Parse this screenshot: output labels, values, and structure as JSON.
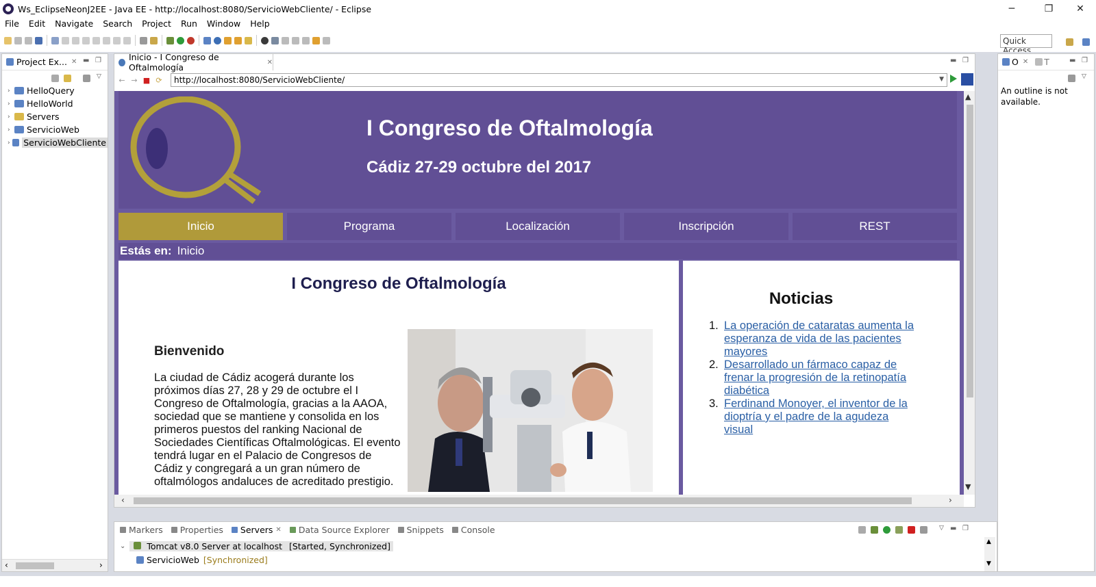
{
  "window": {
    "title": "Ws_EclipseNeonJ2EE - Java EE - http://localhost:8080/ServicioWebCliente/ - Eclipse",
    "controls": [
      "─",
      "❐",
      "✕"
    ]
  },
  "menu": [
    "File",
    "Edit",
    "Navigate",
    "Search",
    "Project",
    "Run",
    "Window",
    "Help"
  ],
  "toolbar": {
    "quick_access": "Quick Access"
  },
  "project_explorer": {
    "tab_label": "Project Ex...",
    "items": [
      "HelloQuery",
      "HelloWorld",
      "Servers",
      "ServicioWeb",
      "ServicioWebCliente"
    ]
  },
  "editor": {
    "tab_label": "Inicio - I Congreso de Oftalmología",
    "url": "http://localhost:8080/ServicioWebCliente/"
  },
  "site": {
    "title": "I Congreso de Oftalmología",
    "subtitle": "Cádiz 27-29 octubre del 2017",
    "nav": [
      "Inicio",
      "Programa",
      "Localización",
      "Inscripción",
      "REST"
    ],
    "breadcrumb_label": "Estás en:",
    "breadcrumb_value": "Inicio",
    "main_title": "I Congreso de Oftalmología",
    "welcome_heading": "Bienvenido",
    "welcome_text": "La ciudad de Cádiz acogerá durante los próximos días 27, 28 y 29 de octubre el I Congreso de Oftalmología, gracias a la AAOA, sociedad que se mantiene y consolida en los primeros puestos del ranking Nacional de Sociedades Científicas Oftalmológicas. El evento tendrá lugar en el Palacio de Congresos de Cádiz y congregará a un gran número de oftalmólogos andaluces de acreditado prestigio.",
    "news_title": "Noticias",
    "news": [
      "La operación de cataratas aumenta la esperanza de vida de las pacientes mayores",
      "Desarrollado un fármaco capaz de frenar la progresión de la retinopatía diabética",
      "Ferdinand Monoyer, el inventor de la dioptría y el padre de la agudeza visual"
    ],
    "colors": {
      "header": "#614f95",
      "active_nav": "#b09a3a",
      "link": "#2a5fa5"
    }
  },
  "outline": {
    "tab_labels": [
      "O",
      "T"
    ],
    "message": "An outline is not available."
  },
  "bottom_panel": {
    "tabs": [
      "Markers",
      "Properties",
      "Servers",
      "Data Source Explorer",
      "Snippets",
      "Console"
    ],
    "server": "Tomcat v8.0 Server at localhost",
    "server_status": "[Started, Synchronized]",
    "child": "ServicioWeb",
    "child_status": "[Synchronized]"
  }
}
